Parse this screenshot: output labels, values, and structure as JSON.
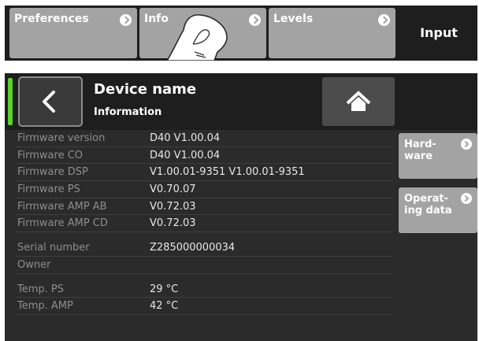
{
  "top_nav": {
    "tabs": [
      {
        "label": "Preferences"
      },
      {
        "label": "Info"
      },
      {
        "label": "Levels"
      }
    ],
    "current_section": "Input"
  },
  "header": {
    "title": "Device name",
    "subtitle": "Information",
    "status_color": "#5bd12a"
  },
  "info_rows": [
    {
      "key": "Firmware version",
      "value": "D40 V1.00.04"
    },
    {
      "key": "Firmware CO",
      "value": "D40 V1.00.04"
    },
    {
      "key": "Firmware DSP",
      "value": "V1.00.01-9351 V1.00.01-9351"
    },
    {
      "key": "Firmware PS",
      "value": "V0.70.07"
    },
    {
      "key": "Firmware AMP AB",
      "value": "V0.72.03"
    },
    {
      "key": "Firmware AMP CD",
      "value": "V0.72.03"
    },
    {
      "key": "Serial number",
      "value": "Z285000000034"
    },
    {
      "key": "Owner",
      "value": ""
    },
    {
      "key": "Temp. PS",
      "value": "29 °C"
    },
    {
      "key": "Temp. AMP",
      "value": "42 °C"
    }
  ],
  "side_buttons": [
    {
      "label": "Hard-\nware"
    },
    {
      "label": "Operat-\ning data"
    }
  ],
  "icons": {
    "back": "chevron-left-icon",
    "home": "home-icon",
    "tab_arrow": "chevron-right-circle-icon",
    "pointer": "hand-pointer-icon"
  }
}
